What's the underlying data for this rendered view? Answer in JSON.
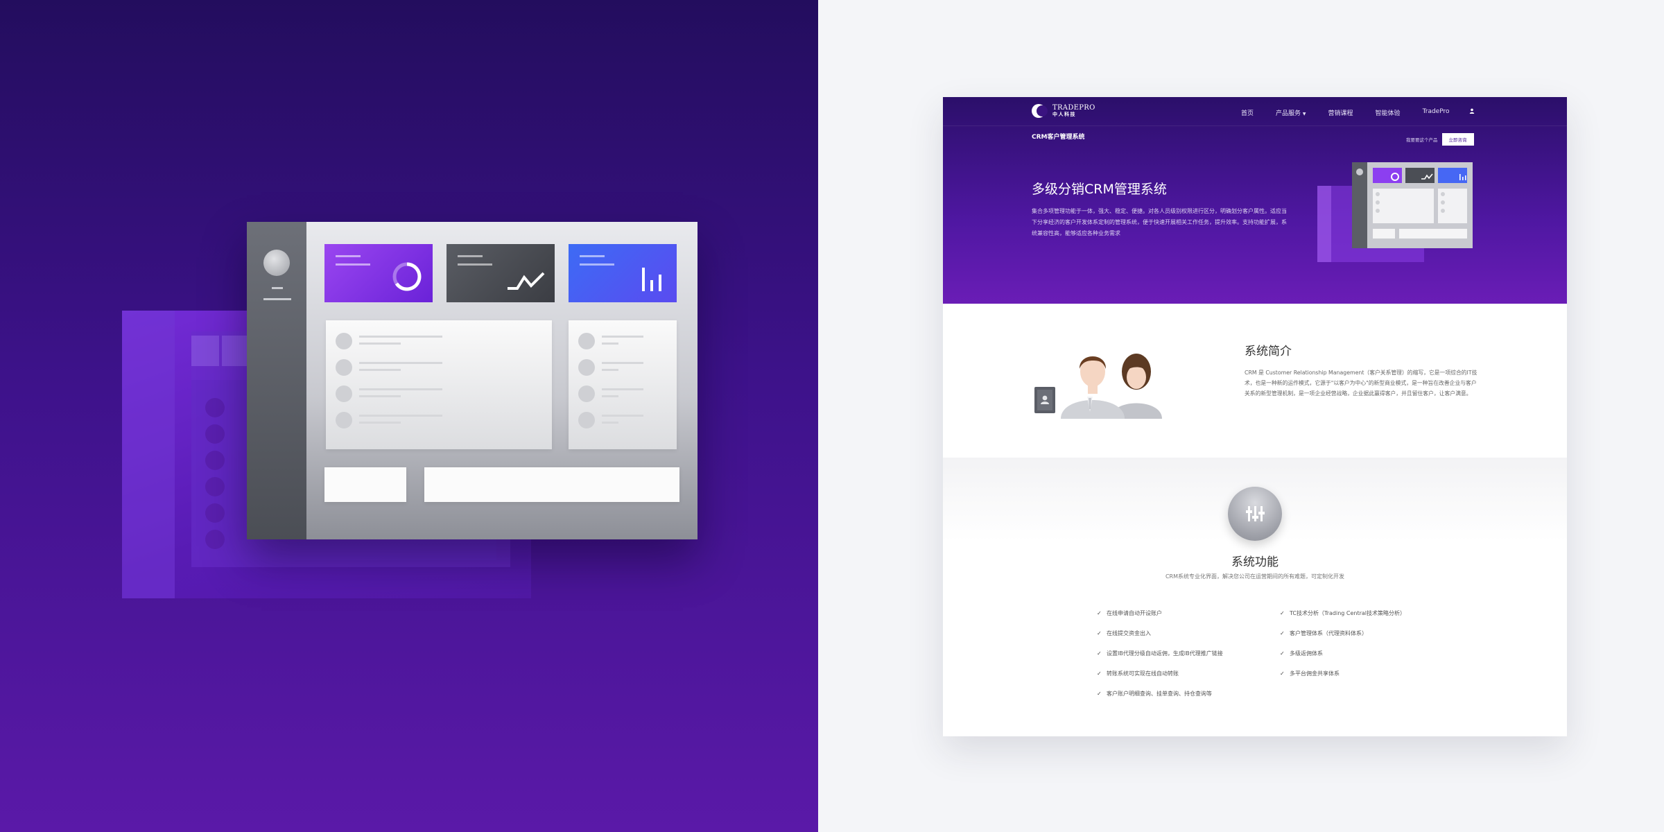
{
  "nav": {
    "logo_en": "TRADEPRO",
    "logo_cn": "中人科技",
    "links": [
      "首页",
      "产品服务",
      "营销课程",
      "智能体验",
      "TradePro"
    ],
    "user_icon": "user-icon"
  },
  "subnav": {
    "title": "CRM客户管理系统",
    "link": "我要要这个产品",
    "button": "立即咨询"
  },
  "hero": {
    "title": "多级分销CRM管理系统",
    "desc": "集合多项管理功能于一体，强大、稳定、便捷。对各人员级别权限进行区分，明确划分客户属性。适应当下分享经济的客户开发体系定制的管理系统，便于快速开展相关工作任务，提升效率。支持功能扩展，系统兼容性高，能够适应各种业务需求"
  },
  "intro": {
    "title": "系统简介",
    "text": "CRM 是 Customer Relationship Management（客户关系管理）的缩写，它是一项综合的IT技术，也是一种新的运作模式，它源于\"以客户为中心\"的新型商业模式，是一种旨在改善企业与客户关系的新型管理机制，是一项企业经营战略，企业据此赢得客户，并且留住客户，让客户满意。"
  },
  "features": {
    "title": "系统功能",
    "subtitle": "CRM系统专业化界面，解决您公司在运营期间的所有难题，可定制化开发",
    "left": [
      "在线申请自动开设账户",
      "在线提交资金出入",
      "设置IB代理分级自动返佣，生成IB代理推广链接",
      "转账系统可实现在线自动转账",
      "客户账户明细查询、挂单查询、持仓查询等"
    ],
    "right": [
      "TC技术分析（Trading Central技术策略分析）",
      "客户管理体系（代理资料体系）",
      "多级返佣体系",
      "多平台佣金共享体系"
    ]
  },
  "colors": {
    "hero_top": "#2b0f6a",
    "hero_bottom": "#6a1db6",
    "left_bg_top": "#230d5e",
    "left_bg_bottom": "#5a19a8",
    "card_purple": "#9a46f0",
    "card_dark": "#4a4d53",
    "card_blue": "#3d6bf5"
  }
}
